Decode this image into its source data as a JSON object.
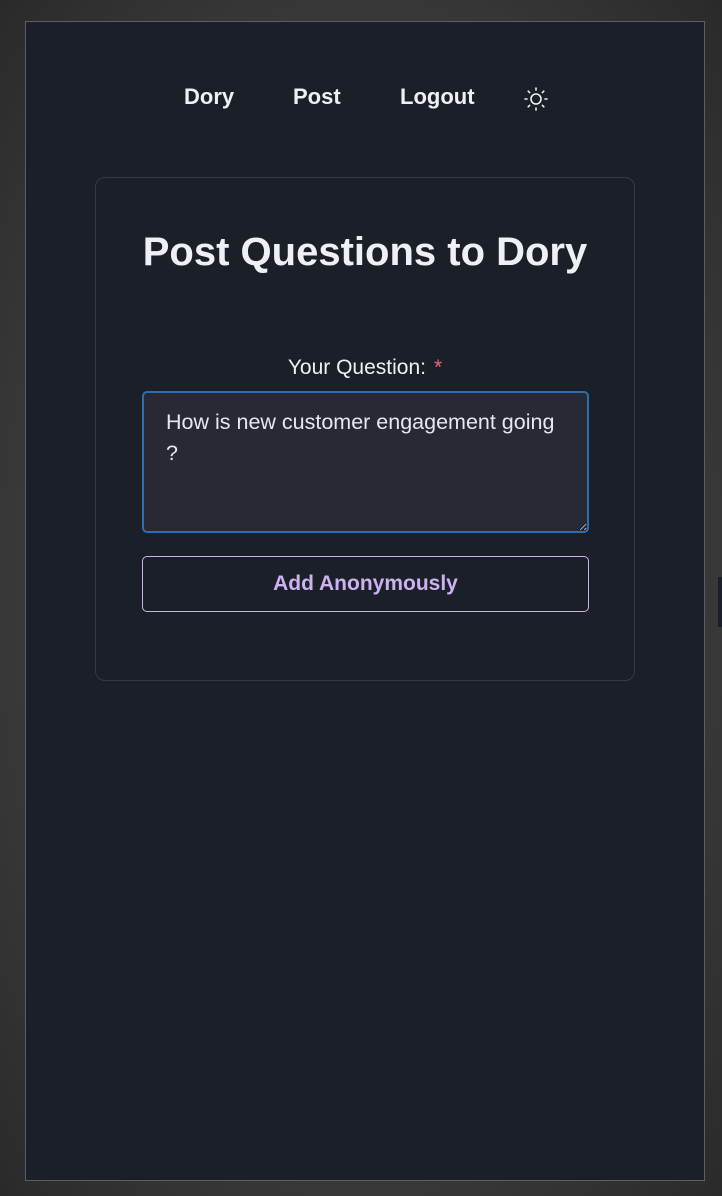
{
  "nav": {
    "links": [
      {
        "label": "Dory"
      },
      {
        "label": "Post"
      },
      {
        "label": "Logout"
      }
    ],
    "theme_icon": "sun-icon"
  },
  "card": {
    "title": "Post Questions to Dory",
    "field_label": "Your Question:",
    "required_marker": "*",
    "question_value": "How is new customer engagement going ?",
    "submit_label": "Add Anonymously"
  },
  "colors": {
    "background": "#1b1f28",
    "text": "#eef0f4",
    "input_focus_border": "#2e6db2",
    "button_accent": "#cdb2f2",
    "required": "#f0676d"
  }
}
